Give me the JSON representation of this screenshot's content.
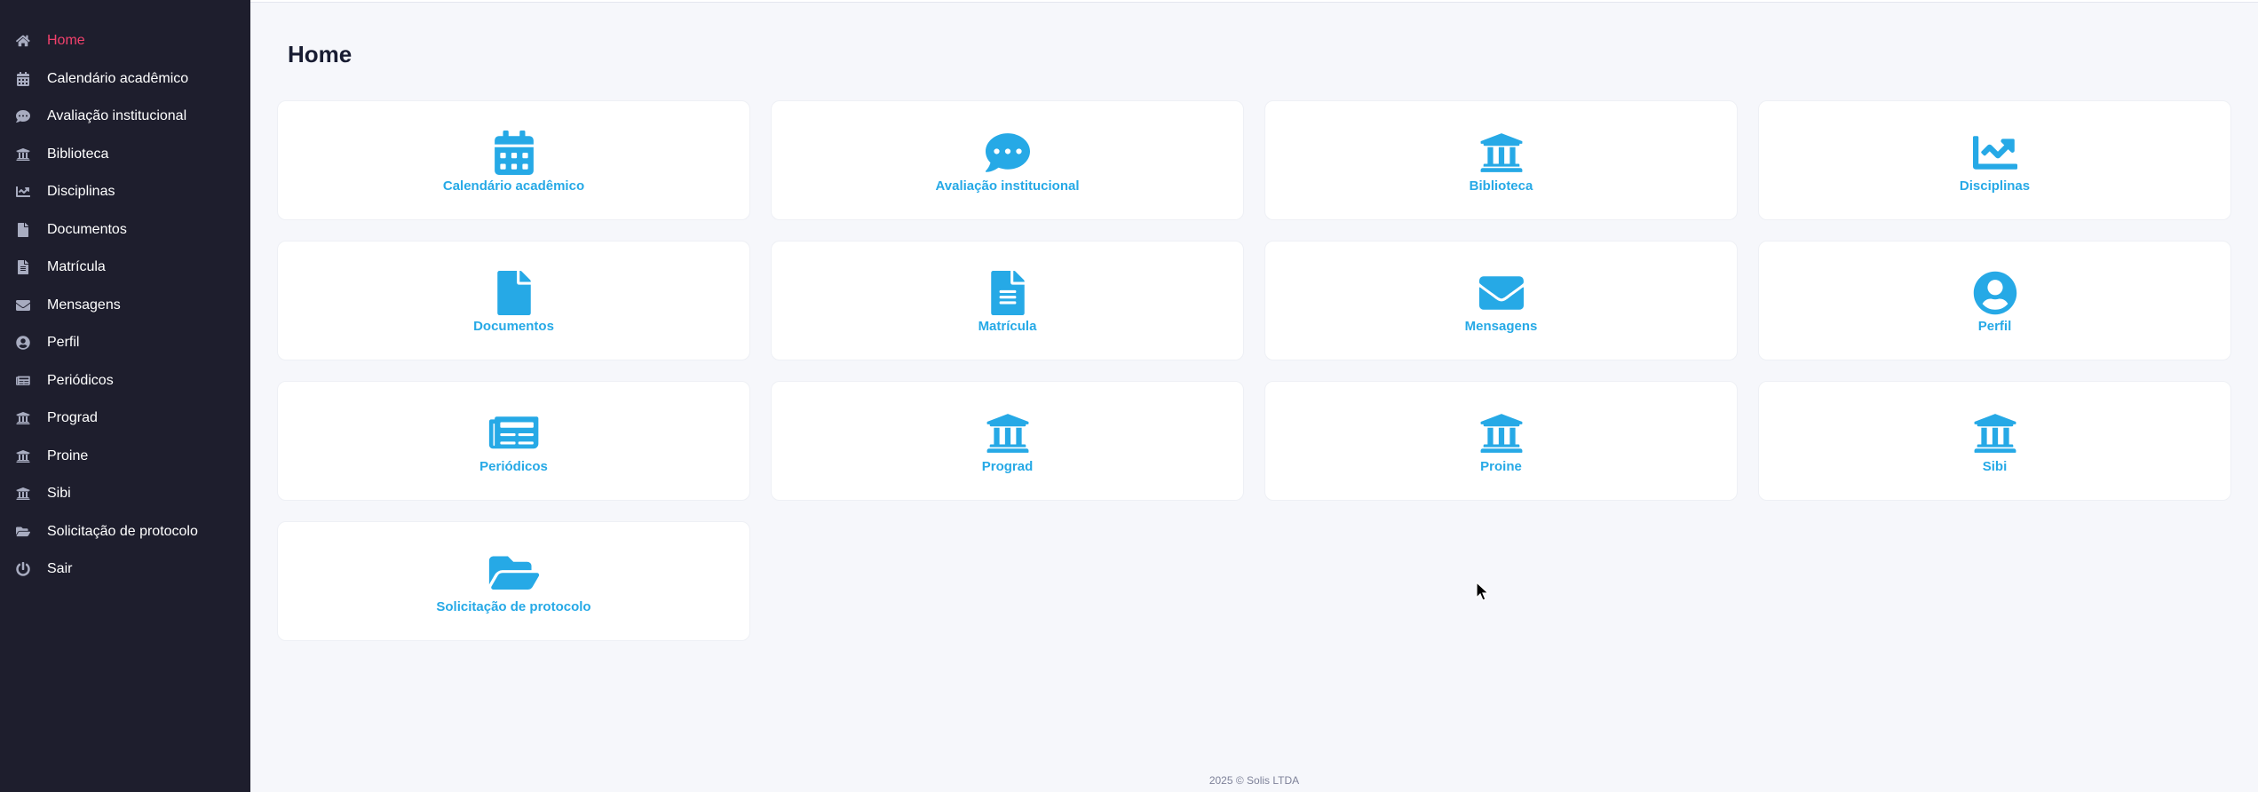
{
  "sidebar": {
    "items": [
      {
        "label": "Home",
        "icon": "home-icon",
        "active": true
      },
      {
        "label": "Calendário acadêmico",
        "icon": "calendar-icon"
      },
      {
        "label": "Avaliação institucional",
        "icon": "comments-icon"
      },
      {
        "label": "Biblioteca",
        "icon": "bank-icon"
      },
      {
        "label": "Disciplinas",
        "icon": "chart-line-icon"
      },
      {
        "label": "Documentos",
        "icon": "file-icon"
      },
      {
        "label": "Matrícula",
        "icon": "file-alt-icon"
      },
      {
        "label": "Mensagens",
        "icon": "envelope-icon"
      },
      {
        "label": "Perfil",
        "icon": "user-circle-icon"
      },
      {
        "label": "Periódicos",
        "icon": "newspaper-icon"
      },
      {
        "label": "Prograd",
        "icon": "bank-icon"
      },
      {
        "label": "Proine",
        "icon": "bank-icon"
      },
      {
        "label": "Sibi",
        "icon": "bank-icon"
      },
      {
        "label": "Solicitação de protocolo",
        "icon": "folder-open-icon"
      },
      {
        "label": "Sair",
        "icon": "power-icon"
      }
    ]
  },
  "main": {
    "title": "Home",
    "cards": [
      {
        "label": "Calendário acadêmico",
        "icon": "calendar-icon"
      },
      {
        "label": "Avaliação institucional",
        "icon": "comments-icon"
      },
      {
        "label": "Biblioteca",
        "icon": "bank-icon"
      },
      {
        "label": "Disciplinas",
        "icon": "chart-line-icon"
      },
      {
        "label": "Documentos",
        "icon": "file-icon"
      },
      {
        "label": "Matrícula",
        "icon": "file-alt-icon"
      },
      {
        "label": "Mensagens",
        "icon": "envelope-icon"
      },
      {
        "label": "Perfil",
        "icon": "user-circle-icon"
      },
      {
        "label": "Periódicos",
        "icon": "newspaper-icon"
      },
      {
        "label": "Prograd",
        "icon": "bank-icon"
      },
      {
        "label": "Proine",
        "icon": "bank-icon"
      },
      {
        "label": "Sibi",
        "icon": "bank-icon"
      },
      {
        "label": "Solicitação de protocolo",
        "icon": "folder-open-icon"
      }
    ]
  },
  "footer": {
    "text": "2025 © Solis LTDA"
  },
  "colors": {
    "sidebar_bg": "#1e1e2d",
    "active": "#f1416c",
    "accent": "#26a9e6",
    "page_bg": "#f6f7fb"
  }
}
